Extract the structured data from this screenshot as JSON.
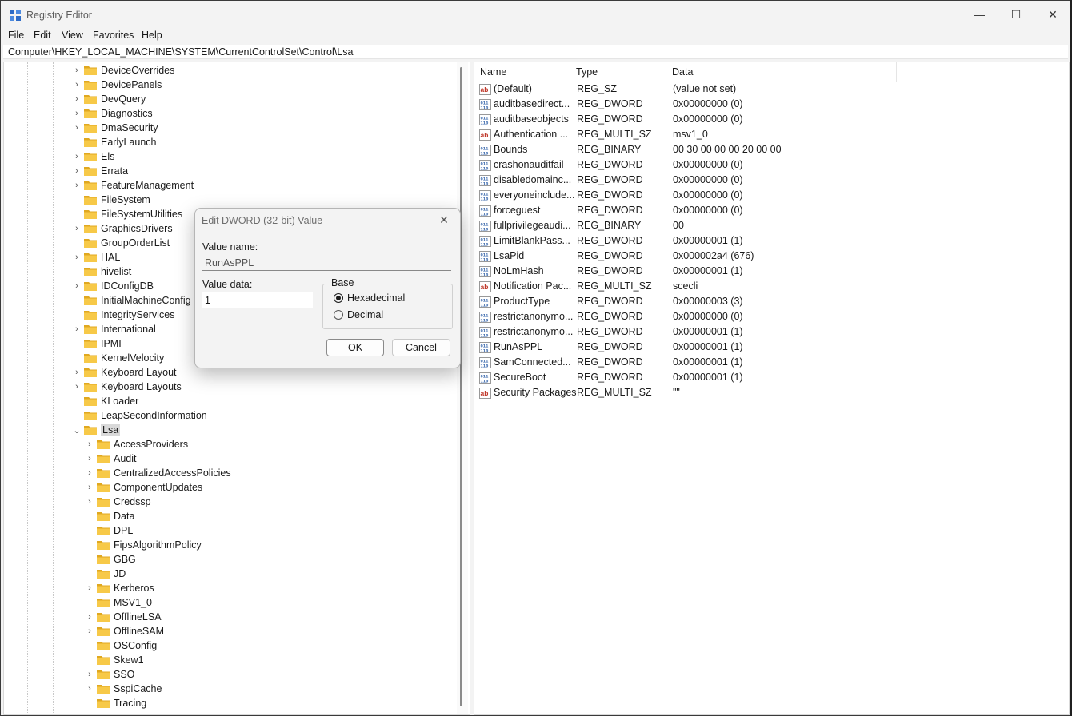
{
  "window": {
    "title": "Registry Editor",
    "minimize_glyph": "—",
    "maximize_glyph": "☐",
    "close_glyph": "✕"
  },
  "menu": [
    "File",
    "Edit",
    "View",
    "Favorites",
    "Help"
  ],
  "address": "Computer\\HKEY_LOCAL_MACHINE\\SYSTEM\\CurrentControlSet\\Control\\Lsa",
  "tree": [
    {
      "label": "DeviceOverrides",
      "expander": "›"
    },
    {
      "label": "DevicePanels",
      "expander": "›"
    },
    {
      "label": "DevQuery",
      "expander": "›"
    },
    {
      "label": "Diagnostics",
      "expander": "›"
    },
    {
      "label": "DmaSecurity",
      "expander": "›"
    },
    {
      "label": "EarlyLaunch",
      "expander": ""
    },
    {
      "label": "Els",
      "expander": "›"
    },
    {
      "label": "Errata",
      "expander": "›"
    },
    {
      "label": "FeatureManagement",
      "expander": "›"
    },
    {
      "label": "FileSystem",
      "expander": ""
    },
    {
      "label": "FileSystemUtilities",
      "expander": ""
    },
    {
      "label": "GraphicsDrivers",
      "expander": "›"
    },
    {
      "label": "GroupOrderList",
      "expander": ""
    },
    {
      "label": "HAL",
      "expander": "›"
    },
    {
      "label": "hivelist",
      "expander": ""
    },
    {
      "label": "IDConfigDB",
      "expander": "›"
    },
    {
      "label": "InitialMachineConfig",
      "expander": ""
    },
    {
      "label": "IntegrityServices",
      "expander": ""
    },
    {
      "label": "International",
      "expander": "›"
    },
    {
      "label": "IPMI",
      "expander": ""
    },
    {
      "label": "KernelVelocity",
      "expander": ""
    },
    {
      "label": "Keyboard Layout",
      "expander": "›"
    },
    {
      "label": "Keyboard Layouts",
      "expander": "›"
    },
    {
      "label": "KLoader",
      "expander": ""
    },
    {
      "label": "LeapSecondInformation",
      "expander": ""
    },
    {
      "label": "Lsa",
      "expander": "⌄",
      "selected": true
    },
    {
      "label": "AccessProviders",
      "expander": "›",
      "child": true
    },
    {
      "label": "Audit",
      "expander": "›",
      "child": true
    },
    {
      "label": "CentralizedAccessPolicies",
      "expander": "›",
      "child": true
    },
    {
      "label": "ComponentUpdates",
      "expander": "›",
      "child": true
    },
    {
      "label": "Credssp",
      "expander": "›",
      "child": true
    },
    {
      "label": "Data",
      "expander": "",
      "child": true
    },
    {
      "label": "DPL",
      "expander": "",
      "child": true
    },
    {
      "label": "FipsAlgorithmPolicy",
      "expander": "",
      "child": true
    },
    {
      "label": "GBG",
      "expander": "",
      "child": true
    },
    {
      "label": "JD",
      "expander": "",
      "child": true
    },
    {
      "label": "Kerberos",
      "expander": "›",
      "child": true
    },
    {
      "label": "MSV1_0",
      "expander": "",
      "child": true
    },
    {
      "label": "OfflineLSA",
      "expander": "›",
      "child": true
    },
    {
      "label": "OfflineSAM",
      "expander": "›",
      "child": true
    },
    {
      "label": "OSConfig",
      "expander": "",
      "child": true
    },
    {
      "label": "Skew1",
      "expander": "",
      "child": true
    },
    {
      "label": "SSO",
      "expander": "›",
      "child": true
    },
    {
      "label": "SspiCache",
      "expander": "›",
      "child": true
    },
    {
      "label": "Tracing",
      "expander": "",
      "child": true
    }
  ],
  "columns": {
    "name": "Name",
    "type": "Type",
    "data": "Data"
  },
  "values": [
    {
      "name": "(Default)",
      "type": "REG_SZ",
      "data": "(value not set)",
      "icon": "string-value-icon"
    },
    {
      "name": "auditbasedirect...",
      "type": "REG_DWORD",
      "data": "0x00000000 (0)",
      "icon": "binary-value-icon"
    },
    {
      "name": "auditbaseobjects",
      "type": "REG_DWORD",
      "data": "0x00000000 (0)",
      "icon": "binary-value-icon"
    },
    {
      "name": "Authentication ...",
      "type": "REG_MULTI_SZ",
      "data": "msv1_0",
      "icon": "string-value-icon"
    },
    {
      "name": "Bounds",
      "type": "REG_BINARY",
      "data": "00 30 00 00 00 20 00 00",
      "icon": "binary-value-icon"
    },
    {
      "name": "crashonauditfail",
      "type": "REG_DWORD",
      "data": "0x00000000 (0)",
      "icon": "binary-value-icon"
    },
    {
      "name": "disabledomainc...",
      "type": "REG_DWORD",
      "data": "0x00000000 (0)",
      "icon": "binary-value-icon"
    },
    {
      "name": "everyoneinclude...",
      "type": "REG_DWORD",
      "data": "0x00000000 (0)",
      "icon": "binary-value-icon"
    },
    {
      "name": "forceguest",
      "type": "REG_DWORD",
      "data": "0x00000000 (0)",
      "icon": "binary-value-icon"
    },
    {
      "name": "fullprivilegeaudi...",
      "type": "REG_BINARY",
      "data": "00",
      "icon": "binary-value-icon"
    },
    {
      "name": "LimitBlankPass...",
      "type": "REG_DWORD",
      "data": "0x00000001 (1)",
      "icon": "binary-value-icon"
    },
    {
      "name": "LsaPid",
      "type": "REG_DWORD",
      "data": "0x000002a4 (676)",
      "icon": "binary-value-icon"
    },
    {
      "name": "NoLmHash",
      "type": "REG_DWORD",
      "data": "0x00000001 (1)",
      "icon": "binary-value-icon"
    },
    {
      "name": "Notification Pac...",
      "type": "REG_MULTI_SZ",
      "data": "scecli",
      "icon": "string-value-icon"
    },
    {
      "name": "ProductType",
      "type": "REG_DWORD",
      "data": "0x00000003 (3)",
      "icon": "binary-value-icon"
    },
    {
      "name": "restrictanonymo...",
      "type": "REG_DWORD",
      "data": "0x00000000 (0)",
      "icon": "binary-value-icon"
    },
    {
      "name": "restrictanonymo...",
      "type": "REG_DWORD",
      "data": "0x00000001 (1)",
      "icon": "binary-value-icon"
    },
    {
      "name": "RunAsPPL",
      "type": "REG_DWORD",
      "data": "0x00000001 (1)",
      "icon": "binary-value-icon"
    },
    {
      "name": "SamConnected...",
      "type": "REG_DWORD",
      "data": "0x00000001 (1)",
      "icon": "binary-value-icon"
    },
    {
      "name": "SecureBoot",
      "type": "REG_DWORD",
      "data": "0x00000001 (1)",
      "icon": "binary-value-icon"
    },
    {
      "name": "Security Packages",
      "type": "REG_MULTI_SZ",
      "data": "\"\"",
      "icon": "string-value-icon"
    }
  ],
  "dialog": {
    "title": "Edit DWORD (32-bit) Value",
    "close_glyph": "✕",
    "value_name_label": "Value name:",
    "value_name": "RunAsPPL",
    "value_data_label": "Value data:",
    "value_data": "1",
    "base_label": "Base",
    "hex_label": "Hexadecimal",
    "dec_label": "Decimal",
    "selected_base": "Hexadecimal",
    "ok_label": "OK",
    "cancel_label": "Cancel"
  },
  "colors": {
    "folder": "#f7c948",
    "folder_dark": "#e0a820",
    "string_icon": "#c0392b",
    "binary_icon": "#2e5fa8",
    "selection": "#d9d9d9"
  }
}
